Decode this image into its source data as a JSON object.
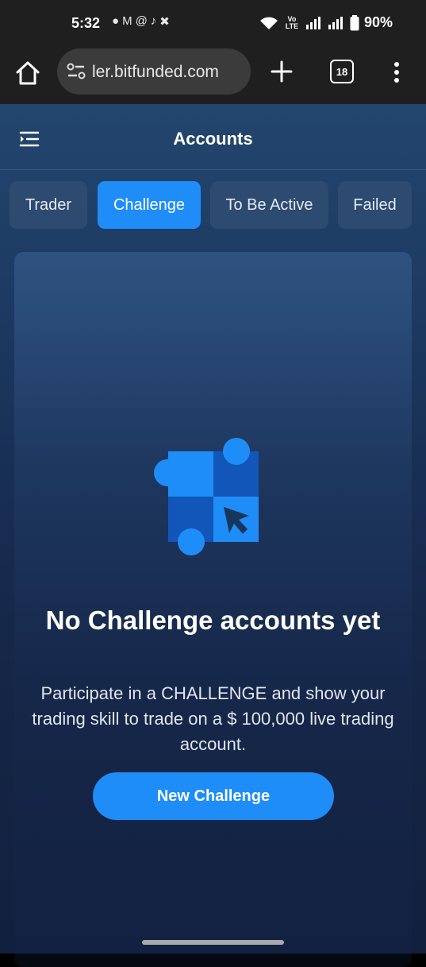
{
  "status_bar": {
    "time": "5:32",
    "network": "Vo LTE",
    "battery": "90%"
  },
  "browser": {
    "url": "ler.bitfunded.com",
    "tab_count": "18"
  },
  "app": {
    "title": "Accounts",
    "tabs": [
      {
        "label": "Trader",
        "active": false
      },
      {
        "label": "Challenge",
        "active": true
      },
      {
        "label": "To Be Active",
        "active": false
      },
      {
        "label": "Failed",
        "active": false
      }
    ],
    "empty_state": {
      "title": "No Challenge accounts yet",
      "description": "Participate in a CHALLENGE and show your trading skill to trade on a $ 100,000 live trading account.",
      "button_label": "New Challenge"
    }
  },
  "colors": {
    "accent": "#1f8df8",
    "illustration_dark": "#1156b8",
    "illustration_light": "#1f8df8"
  }
}
